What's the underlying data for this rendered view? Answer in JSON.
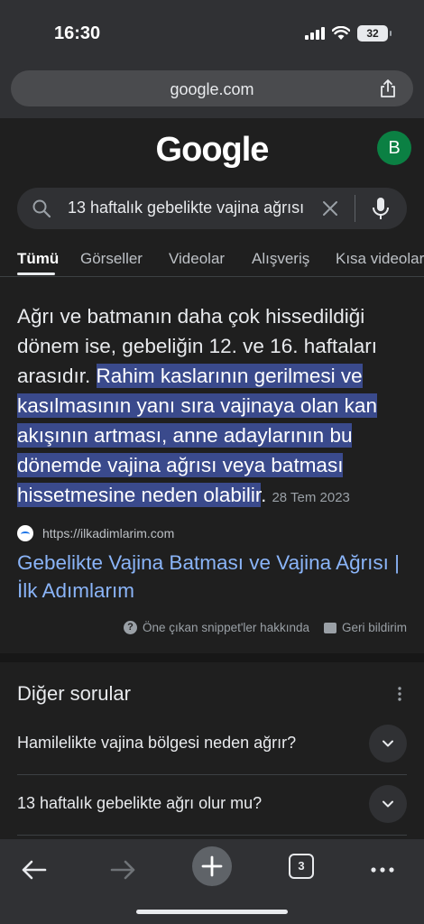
{
  "status": {
    "time": "16:30",
    "battery": "32"
  },
  "browser": {
    "url": "google.com",
    "tab_count": "3"
  },
  "google": {
    "logo": "Google",
    "avatar_letter": "B",
    "avatar_color": "#0b8043"
  },
  "search": {
    "query": "13 haftalık gebelikte vajina ağrısı"
  },
  "tabs": [
    "Tümü",
    "Görseller",
    "Videolar",
    "Alışveriş",
    "Kısa videolar"
  ],
  "snippet": {
    "plain": "Ağrı ve batmanın daha çok hissedildiği dönem ise, gebeliğin 12. ve 16. haftaları arasıdır. ",
    "highlighted": "Rahim kaslarının gerilmesi ve kasılmasının yanı sıra vajinaya olan kan akışının artması, anne adaylarının bu dönemde vajina ağrısı veya batması hissetmesine neden olabilir",
    "tail": ".",
    "date": "28 Tem 2023"
  },
  "result": {
    "source_url": "https://ilkadimlarim.com",
    "title": "Gebelikte Vajina Batması ve Vajina Ağrısı | İlk Adımlarım"
  },
  "footer": {
    "about": "Öne çıkan snippet'ler hakkında",
    "feedback": "Geri bildirim"
  },
  "other_questions": {
    "title": "Diğer sorular",
    "items": [
      "Hamilelikte vajina bölgesi neden ağrır?",
      "13 haftalık gebelikte ağrı olur mu?"
    ]
  },
  "colors": {
    "highlight": "#3a4a8c",
    "link": "#8ab4f8",
    "background": "#1f1f1f"
  }
}
